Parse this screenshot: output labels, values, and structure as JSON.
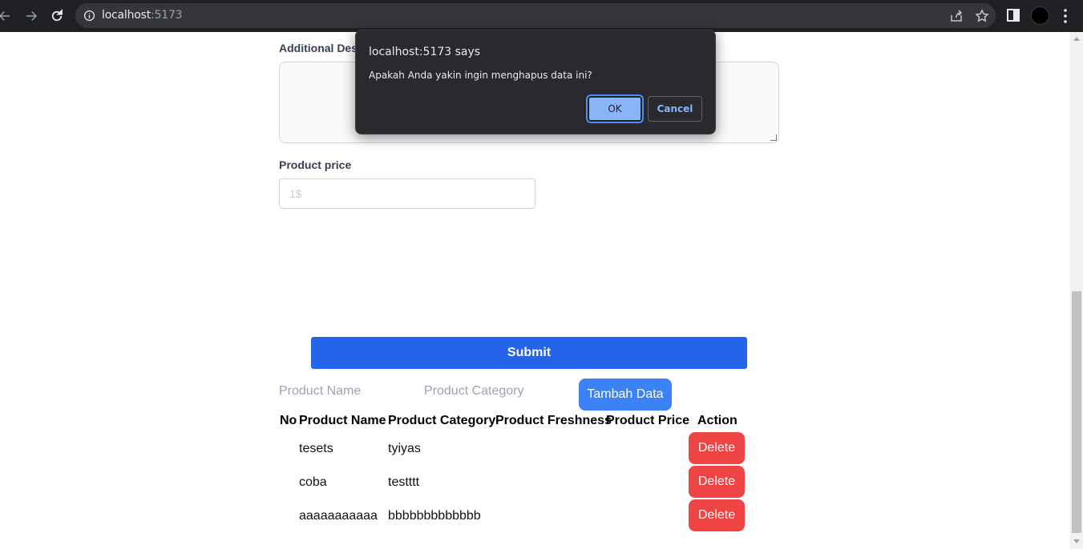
{
  "browser": {
    "url_host": "localhost",
    "url_port": ":5173"
  },
  "form": {
    "description_label": "Additional Desc",
    "price_label": "Product price",
    "price_placeholder": "1$",
    "submit_label": "Submit"
  },
  "search": {
    "name_placeholder": "Product Name",
    "category_placeholder": "Product Category",
    "add_button": "Tambah Data"
  },
  "table": {
    "headers": [
      "No",
      "Product Name",
      "Product Category",
      "Product Freshness",
      "Product Price",
      "Action"
    ],
    "rows": [
      {
        "name": "tesets",
        "category": "tyiyas",
        "action": "Delete"
      },
      {
        "name": "coba",
        "category": "testttt",
        "action": "Delete"
      },
      {
        "name": "aaaaaaaaaaa",
        "category": "bbbbbbbbbbbbb",
        "action": "Delete"
      }
    ]
  },
  "dialog": {
    "title": "localhost:5173 says",
    "message": "Apakah Anda yakin ingin menghapus data ini?",
    "ok_label": "OK",
    "cancel_label": "Cancel"
  },
  "colors": {
    "primary": "#2563eb",
    "add_button": "#3b82f6",
    "delete_button": "#ef4444",
    "dialog_bg": "#292a2d",
    "dialog_ok": "#8ab4f8"
  }
}
